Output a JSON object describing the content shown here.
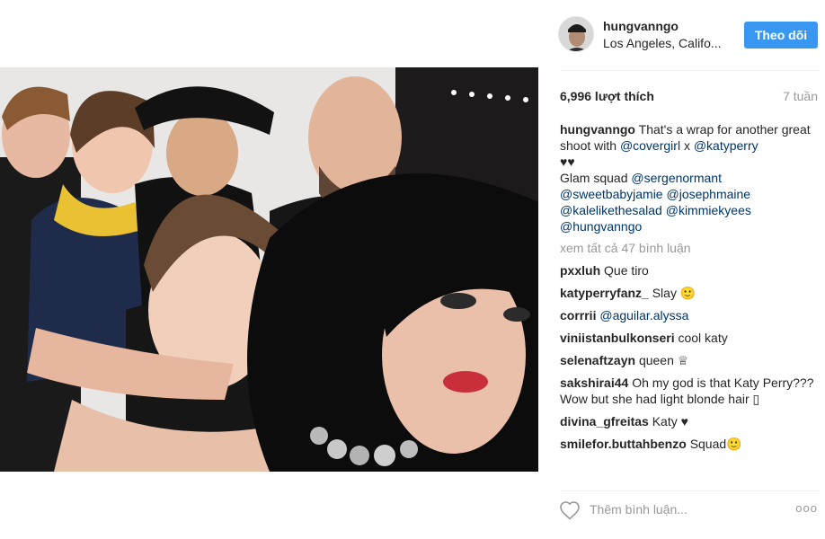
{
  "photo": {
    "alt_icon": "photo"
  },
  "header": {
    "username": "hungvanngo",
    "location": "Los Angeles, Califo...",
    "follow_label": "Theo dõi"
  },
  "stats": {
    "likes": "6,996 lượt thích",
    "time": "7 tuần"
  },
  "caption": {
    "author": "hungvanngo",
    "line1_text": "That's a wrap for another great shoot with",
    "mention1": "@covergirl",
    "x_sep": "x",
    "mention2": "@katyperry",
    "hearts": "♥♥",
    "glam_label": "Glam squad",
    "m3": "@sergenormant",
    "m4": "@sweetbabyjamie",
    "m5": "@josephmaine",
    "m6": "@kalelikethesalad",
    "m7": "@kimmiekyees",
    "m8": "@hungvanngo"
  },
  "view_all": "xem tất cả 47 bình luận",
  "comments": [
    {
      "user": "pxxluh",
      "text": "Que tiro"
    },
    {
      "user": "katyperryfanz_",
      "text": "Slay 🙂"
    },
    {
      "user": "corrrii",
      "mention": "@aguilar.alyssa"
    },
    {
      "user": "viniistanbulkonseri",
      "text": "cool katy"
    },
    {
      "user": "selenaftzayn",
      "text": "queen ♕"
    },
    {
      "user": "sakshirai44",
      "text": "Oh my god is that Katy Perry??? Wow but she had light blonde hair ▯"
    },
    {
      "user": "divina_gfreitas",
      "text": "Katy ♥"
    },
    {
      "user": "smilefor.buttahbenzo",
      "text": "Squad🙂"
    }
  ],
  "add_comment": {
    "placeholder": "Thêm bình luận...",
    "more": "ooo"
  },
  "colors": {
    "follow_button": "#3897f0",
    "mention": "#003569",
    "muted": "#999999"
  }
}
